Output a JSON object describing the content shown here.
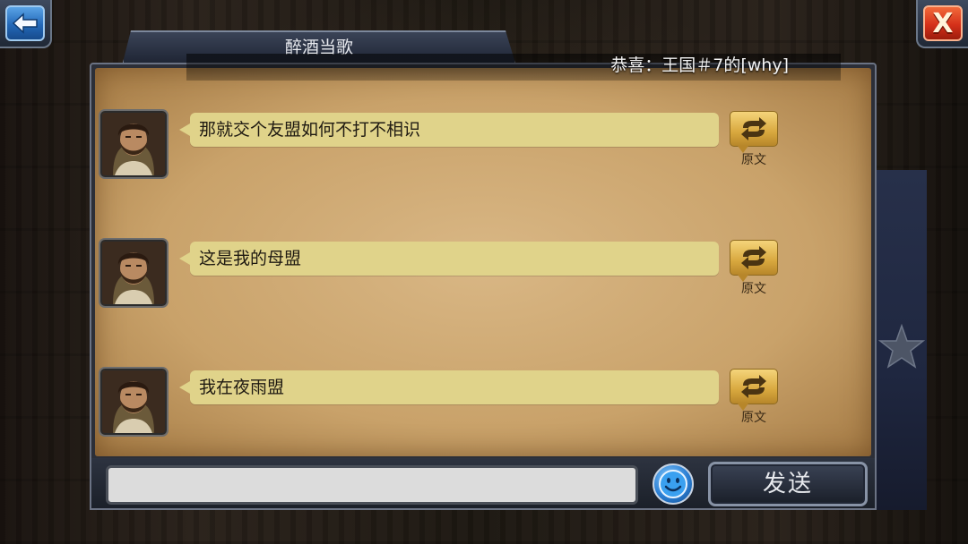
{
  "header": {
    "channel_title": "醉酒当歌",
    "announcement": "恭喜：王国＃7的[why]"
  },
  "messages": [
    {
      "text": "那就交个友盟如何不打不相识",
      "translate_label": "原文"
    },
    {
      "text": "这是我的母盟",
      "translate_label": "原文"
    },
    {
      "text": "我在夜雨盟",
      "translate_label": "原文"
    }
  ],
  "input": {
    "value": "",
    "placeholder": ""
  },
  "buttons": {
    "send_label": "发送",
    "close_label": "X"
  },
  "colors": {
    "parchment": "#c9a26a",
    "bubble": "#e0d38a",
    "back_button": "#2368b8",
    "close_button": "#d5301a"
  },
  "icons": {
    "back": "arrow-left-icon",
    "close": "close-icon",
    "translate": "translate-arrows-icon",
    "emoji": "smiley-icon",
    "favorite": "star-icon"
  }
}
